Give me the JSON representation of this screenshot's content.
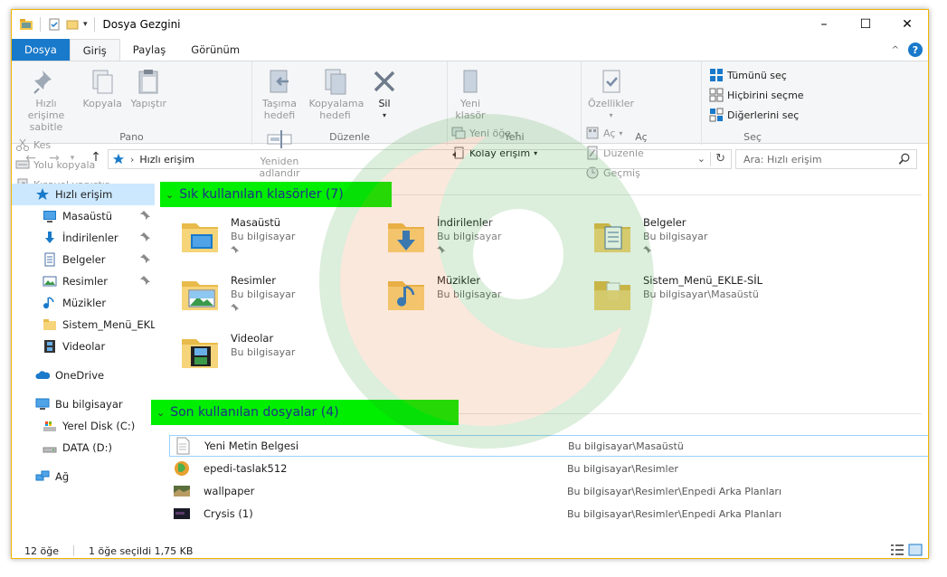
{
  "window": {
    "title": "Dosya Gezgini",
    "controls": {
      "minimize": "–",
      "maximize": "☐",
      "close": "✕"
    }
  },
  "ribbon": {
    "tabs": [
      {
        "label": "Dosya"
      },
      {
        "label": "Giriş"
      },
      {
        "label": "Paylaş"
      },
      {
        "label": "Görünüm"
      }
    ],
    "groups": {
      "pano": {
        "label": "Pano",
        "pin": "Hızlı erişime sabitle",
        "copy": "Kopyala",
        "paste": "Yapıştır",
        "cut": "Kes",
        "copy_path": "Yolu kopyala",
        "paste_shortcut": "Kısayol yapıştır"
      },
      "duzenle": {
        "label": "Düzenle",
        "move_to": "Taşıma hedefi",
        "copy_to": "Kopyalama hedefi",
        "delete": "Sil",
        "rename": "Yeniden adlandır"
      },
      "yeni": {
        "label": "Yeni",
        "new_folder": "Yeni klasör",
        "new_item": "Yeni öğe",
        "easy_access": "Kolay erişim"
      },
      "ac": {
        "label": "Aç",
        "properties": "Özellikler",
        "open": "Aç",
        "edit": "Düzenle",
        "history": "Geçmiş"
      },
      "sec": {
        "label": "Seç",
        "select_all": "Tümünü seç",
        "select_none": "Hiçbirini seçme",
        "invert": "Diğerlerini seç"
      }
    }
  },
  "address": {
    "path": "Hızlı erişim",
    "search_placeholder": "Ara: Hızlı erişim"
  },
  "nav": {
    "items": [
      {
        "label": "Hızlı erişim"
      },
      {
        "label": "Masaüstü"
      },
      {
        "label": "İndirilenler"
      },
      {
        "label": "Belgeler"
      },
      {
        "label": "Resimler"
      },
      {
        "label": "Müzikler"
      },
      {
        "label": "Sistem_Menü_EKLE-"
      },
      {
        "label": "Videolar"
      },
      {
        "label": "OneDrive"
      },
      {
        "label": "Bu bilgisayar"
      },
      {
        "label": "Yerel Disk (C:)"
      },
      {
        "label": "DATA (D:)"
      },
      {
        "label": "Ağ"
      }
    ]
  },
  "frequent": {
    "header": "Sık kullanılan klasörler (7)",
    "folders": [
      {
        "name": "Masaüstü",
        "location": "Bu bilgisayar"
      },
      {
        "name": "İndirilenler",
        "location": "Bu bilgisayar"
      },
      {
        "name": "Belgeler",
        "location": "Bu bilgisayar"
      },
      {
        "name": "Resimler",
        "location": "Bu bilgisayar"
      },
      {
        "name": "Müzikler",
        "location": "Bu bilgisayar"
      },
      {
        "name": "Sistem_Menü_EKLE-SİL",
        "location": "Bu bilgisayar\\Masaüstü"
      },
      {
        "name": "Videolar",
        "location": "Bu bilgisayar"
      }
    ]
  },
  "recent": {
    "header": "Son kullanılan dosyalar (4)",
    "files": [
      {
        "name": "Yeni Metin Belgesi",
        "path": "Bu bilgisayar\\Masaüstü"
      },
      {
        "name": "epedi-taslak512",
        "path": "Bu bilgisayar\\Resimler"
      },
      {
        "name": "wallpaper",
        "path": "Bu bilgisayar\\Resimler\\Enpedi Arka Planları"
      },
      {
        "name": "Crysis (1)",
        "path": "Bu bilgisayar\\Resimler\\Enpedi Arka Planları"
      }
    ]
  },
  "status": {
    "count": "12 öğe",
    "selection": "1 öğe seçildi  1,75 KB"
  },
  "colors": {
    "accent": "#1979ca",
    "group_highlight": "#00ee00",
    "selection": "#cce8ff"
  }
}
